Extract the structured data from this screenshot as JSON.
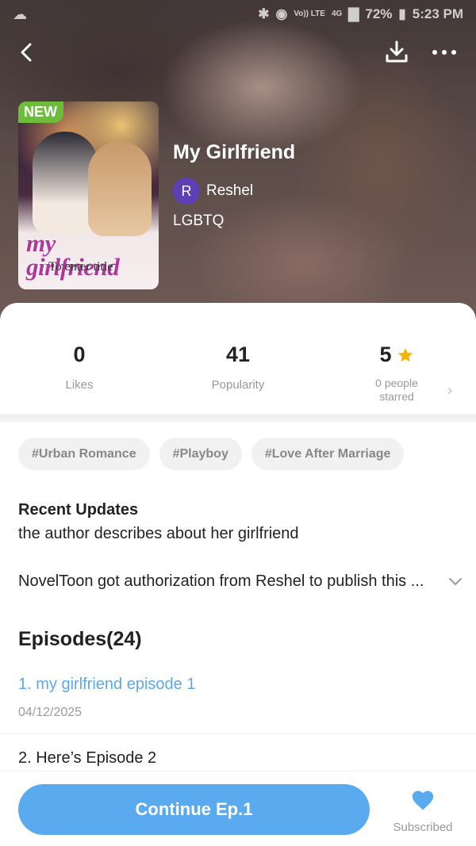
{
  "status_bar": {
    "battery": "72%",
    "time": "5:23 PM",
    "network": "4G",
    "volte": "Vo)) LTE"
  },
  "book": {
    "badge": "NEW",
    "cover_title": "my girlfriend",
    "cover_subtitle": "To enter title",
    "title": "My Girlfriend",
    "author_initial": "R",
    "author": "Reshel",
    "genre": "LGBTQ"
  },
  "stats": {
    "likes_value": "0",
    "likes_label": "Likes",
    "popularity_value": "41",
    "popularity_label": "Popularity",
    "rating_value": "5",
    "rating_label": "0 people starred"
  },
  "tags": [
    "#Urban Romance",
    "#Playboy",
    "#Love After Marriage"
  ],
  "recent": {
    "heading": "Recent Updates",
    "text": "the author describes about her girlfriend"
  },
  "authorization": "NovelToon got authorization from Reshel to publish this ...",
  "episodes": {
    "heading": "Episodes(24)",
    "items": [
      {
        "title": "1. my girlfriend episode 1",
        "date": "04/12/2025"
      },
      {
        "title": "2. Here’s Episode 2"
      }
    ]
  },
  "actions": {
    "continue_label": "Continue Ep.1",
    "subscribe_label": "Subscribed"
  },
  "colors": {
    "accent": "#5aaaf0",
    "new_badge": "#6dbd3a",
    "star": "#f5b400",
    "author_avatar": "#5e3fb6"
  }
}
